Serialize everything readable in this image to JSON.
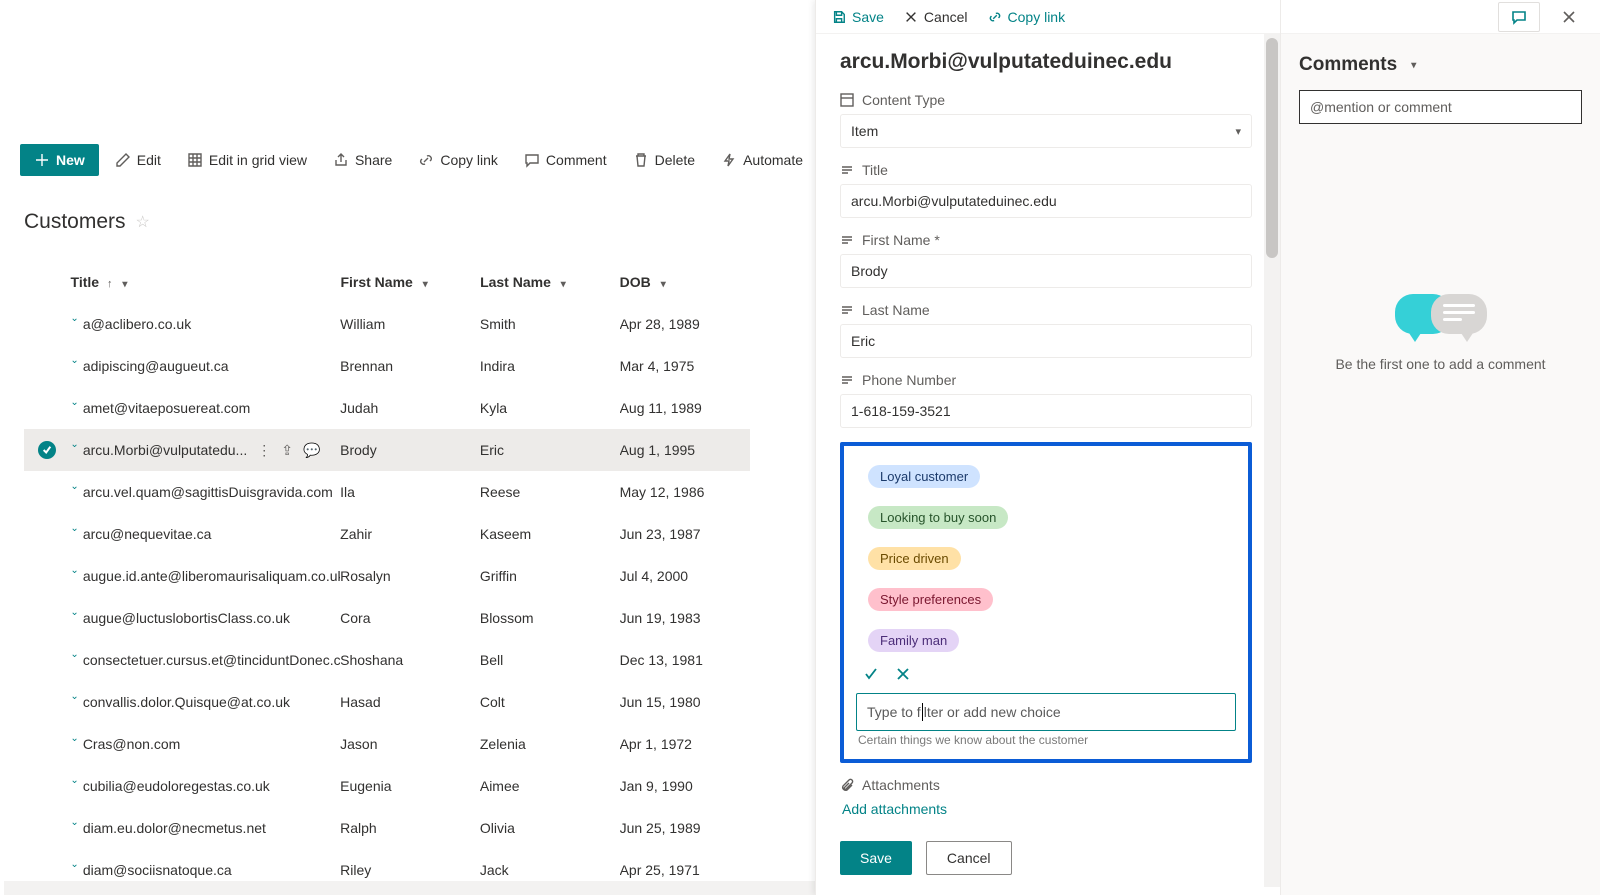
{
  "cmdbar": {
    "new": "New",
    "edit": "Edit",
    "gridview": "Edit in grid view",
    "share": "Share",
    "copylink": "Copy link",
    "comment": "Comment",
    "delete": "Delete",
    "automate": "Automate"
  },
  "list": {
    "title": "Customers",
    "columns": {
      "title": "Title",
      "first": "First Name",
      "last": "Last Name",
      "dob": "DOB"
    },
    "rows": [
      {
        "title": "a@aclibero.co.uk",
        "first": "William",
        "last": "Smith",
        "dob": "Apr 28, 1989"
      },
      {
        "title": "adipiscing@augueut.ca",
        "first": "Brennan",
        "last": "Indira",
        "dob": "Mar 4, 1975"
      },
      {
        "title": "amet@vitaeposuereat.com",
        "first": "Judah",
        "last": "Kyla",
        "dob": "Aug 11, 1989"
      },
      {
        "title": "arcu.Morbi@vulputatedu...",
        "first": "Brody",
        "last": "Eric",
        "dob": "Aug 1, 1995",
        "selected": true
      },
      {
        "title": "arcu.vel.quam@sagittisDuisgravida.com",
        "first": "Ila",
        "last": "Reese",
        "dob": "May 12, 1986"
      },
      {
        "title": "arcu@nequevitae.ca",
        "first": "Zahir",
        "last": "Kaseem",
        "dob": "Jun 23, 1987"
      },
      {
        "title": "augue.id.ante@liberomaurisaliquam.co.uk",
        "first": "Rosalyn",
        "last": "Griffin",
        "dob": "Jul 4, 2000"
      },
      {
        "title": "augue@luctuslobortisClass.co.uk",
        "first": "Cora",
        "last": "Blossom",
        "dob": "Jun 19, 1983"
      },
      {
        "title": "consectetuer.cursus.et@tinciduntDonec.co.uk",
        "first": "Shoshana",
        "last": "Bell",
        "dob": "Dec 13, 1981"
      },
      {
        "title": "convallis.dolor.Quisque@at.co.uk",
        "first": "Hasad",
        "last": "Colt",
        "dob": "Jun 15, 1980"
      },
      {
        "title": "Cras@non.com",
        "first": "Jason",
        "last": "Zelenia",
        "dob": "Apr 1, 1972"
      },
      {
        "title": "cubilia@eudoloregestas.co.uk",
        "first": "Eugenia",
        "last": "Aimee",
        "dob": "Jan 9, 1990"
      },
      {
        "title": "diam.eu.dolor@necmetus.net",
        "first": "Ralph",
        "last": "Olivia",
        "dob": "Jun 25, 1989"
      },
      {
        "title": "diam@sociisnatoque.ca",
        "first": "Riley",
        "last": "Jack",
        "dob": "Apr 25, 1971"
      }
    ]
  },
  "panel": {
    "actions": {
      "save": "Save",
      "cancel": "Cancel",
      "copylink": "Copy link"
    },
    "title": "arcu.Morbi@vulputateduinec.edu",
    "fields": {
      "contentType": {
        "label": "Content Type",
        "value": "Item"
      },
      "title": {
        "label": "Title",
        "value": "arcu.Morbi@vulputateduinec.edu"
      },
      "firstName": {
        "label": "First Name *",
        "value": "Brody"
      },
      "lastName": {
        "label": "Last Name",
        "value": "Eric"
      },
      "phone": {
        "label": "Phone Number",
        "value": "1-618-159-3521"
      },
      "attachments": {
        "label": "Attachments",
        "link": "Add attachments"
      }
    },
    "choices": {
      "options": [
        {
          "label": "Loyal customer",
          "cls": "pill-loyal"
        },
        {
          "label": "Looking to buy soon",
          "cls": "pill-buy"
        },
        {
          "label": "Price driven",
          "cls": "pill-price"
        },
        {
          "label": "Style preferences",
          "cls": "pill-style"
        },
        {
          "label": "Family man",
          "cls": "pill-family"
        }
      ],
      "filterPlaceholderLeft": "Type to f",
      "filterPlaceholderRight": "lter or add new choice",
      "helperText": "Certain things we know about the customer"
    },
    "footer": {
      "save": "Save",
      "cancel": "Cancel"
    }
  },
  "comments": {
    "heading": "Comments",
    "placeholder": "@mention or comment",
    "empty": "Be the first one to add a comment"
  }
}
